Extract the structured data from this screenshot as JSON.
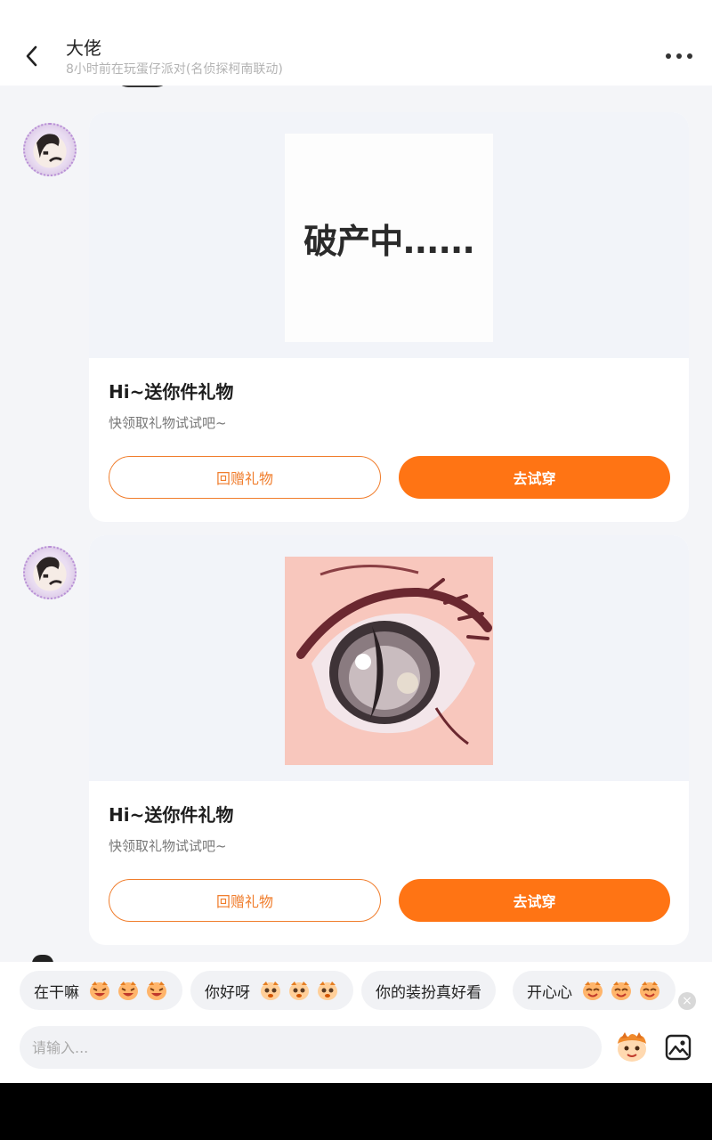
{
  "header": {
    "title": "大佬",
    "subtitle": "8小时前在玩蛋仔派对(名侦探柯南联动)"
  },
  "messages": [
    {
      "gift_image_text": "破产中......",
      "title": "Hi~送你件礼物",
      "desc": "快领取礼物试试吧~",
      "return_label": "回赠礼物",
      "try_label": "去试穿"
    },
    {
      "gift_image_text": "",
      "title": "Hi~送你件礼物",
      "desc": "快领取礼物试试吧~",
      "return_label": "回赠礼物",
      "try_label": "去试穿"
    }
  ],
  "quick_replies": [
    {
      "text": "在干嘛",
      "emoji": "laugh-face-icon"
    },
    {
      "text": "你好呀",
      "emoji": "eggy-face-icon"
    },
    {
      "text": "你的装扮真好看",
      "emoji": ""
    },
    {
      "text": "开心心",
      "emoji": "happy-face-icon"
    }
  ],
  "input": {
    "placeholder": "请输入..."
  },
  "colors": {
    "accent": "#ff7414",
    "accent_outline": "#f07d2c",
    "background": "#f4f5f8"
  }
}
